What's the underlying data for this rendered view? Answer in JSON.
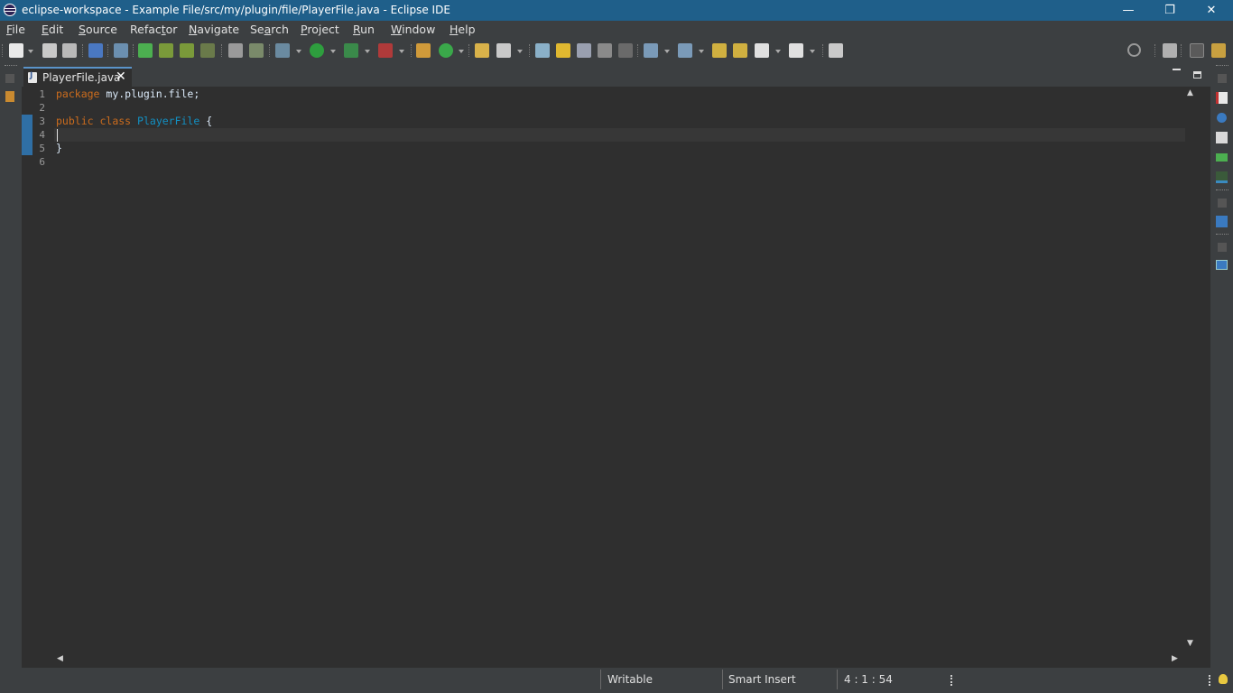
{
  "window": {
    "title": "eclipse-workspace - Example File/src/my/plugin/file/PlayerFile.java - Eclipse IDE",
    "minimize_glyph": "—",
    "restore_glyph": "❐",
    "close_glyph": "✕"
  },
  "menu": [
    {
      "u": "F",
      "rest": "ile"
    },
    {
      "u": "E",
      "rest": "dit"
    },
    {
      "pre": "",
      "u": "S",
      "rest": "ource"
    },
    {
      "pre": "Refac",
      "u": "t",
      "rest": "or"
    },
    {
      "u": "N",
      "rest": "avigate"
    },
    {
      "pre": "Se",
      "u": "a",
      "rest": "rch"
    },
    {
      "u": "P",
      "rest": "roject"
    },
    {
      "u": "R",
      "rest": "un"
    },
    {
      "u": "W",
      "rest": "indow"
    },
    {
      "u": "H",
      "rest": "elp"
    }
  ],
  "editor": {
    "tab_label": "PlayerFile.java",
    "tab_close": "✕",
    "line_numbers": [
      "1",
      "2",
      "3",
      "4",
      "5",
      "6"
    ],
    "code": {
      "l1_kw": "package",
      "l1_rest": " my.plugin.file;",
      "l3_kw1": "public",
      "l3_kw2": "class",
      "l3_cls": "PlayerFile",
      "l3_rest": " {",
      "l5": "}"
    }
  },
  "scroll": {
    "up": "▲",
    "down": "▼",
    "left": "◀",
    "right": "▶"
  },
  "status": {
    "writable": "Writable",
    "insert_mode": "Smart Insert",
    "position": "4 : 1 : 54"
  },
  "colors": {
    "titlebar": "#1f5f8a",
    "keyword": "#cc6c1d",
    "class_name": "#1290c3",
    "background": "#2f2f2f"
  }
}
